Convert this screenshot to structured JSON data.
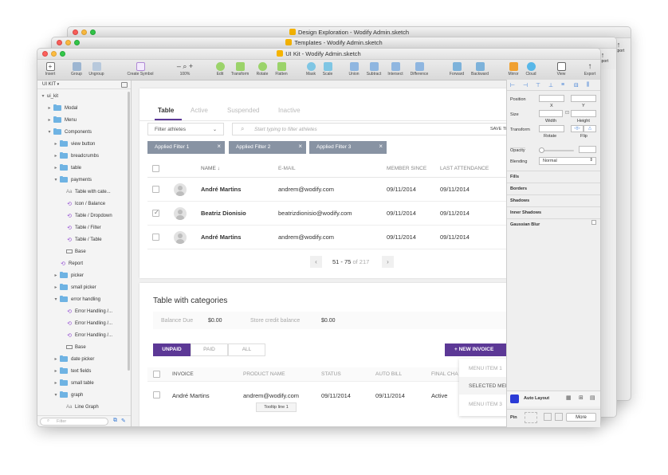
{
  "windows": {
    "back_title": "Design Exploration - Wodify Admin.sketch",
    "mid_title": "Templates - Wodify Admin.sketch",
    "front_title": "UI Kit - Wodify Admin.sketch",
    "back_export_label": "Export",
    "mid_export_label": "Export"
  },
  "toolbar": {
    "insert": "Insert",
    "group": "Group",
    "ungroup": "Ungroup",
    "create_symbol": "Create Symbol",
    "zoom_minus": "–",
    "zoom_plus": "+",
    "zoom_value": "100%",
    "edit": "Edit",
    "transform": "Transform",
    "rotate": "Rotate",
    "flatten": "Flatten",
    "mask": "Mask",
    "scale": "Scale",
    "union": "Union",
    "subtract": "Subtract",
    "intersect": "Intersect",
    "difference": "Difference",
    "forward": "Forward",
    "backward": "Backward",
    "mirror": "Mirror",
    "cloud": "Cloud",
    "view": "View",
    "export": "Export"
  },
  "sidebar": {
    "page": "UI KIT",
    "filter_placeholder": "Filter",
    "layers": [
      {
        "label": "ui_kit",
        "icon": "none",
        "depth": 0,
        "open": true
      },
      {
        "label": "Modal",
        "icon": "folder",
        "depth": 1,
        "open": false
      },
      {
        "label": "Menu",
        "icon": "folder",
        "depth": 1,
        "open": false
      },
      {
        "label": "Components",
        "icon": "folder",
        "depth": 1,
        "open": true
      },
      {
        "label": "view button",
        "icon": "folder",
        "depth": 2,
        "open": false
      },
      {
        "label": "breadcrumbs",
        "icon": "folder",
        "depth": 2,
        "open": false
      },
      {
        "label": "table",
        "icon": "folder",
        "depth": 2,
        "open": false
      },
      {
        "label": "payments",
        "icon": "folder",
        "depth": 2,
        "open": true
      },
      {
        "label": "Table with cate...",
        "icon": "text",
        "depth": 3
      },
      {
        "label": "Icon / Balance",
        "icon": "symbol",
        "depth": 3
      },
      {
        "label": "Table / Dropdown",
        "icon": "symbol",
        "depth": 3
      },
      {
        "label": "Table / Filter",
        "icon": "symbol",
        "depth": 3
      },
      {
        "label": "Table / Table",
        "icon": "symbol",
        "depth": 3
      },
      {
        "label": "Base",
        "icon": "rect",
        "depth": 3
      },
      {
        "label": "Report",
        "icon": "symbol",
        "depth": 2
      },
      {
        "label": "picker",
        "icon": "folder",
        "depth": 2,
        "open": false
      },
      {
        "label": "small picker",
        "icon": "folder",
        "depth": 2,
        "open": false
      },
      {
        "label": "error handling",
        "icon": "folder",
        "depth": 2,
        "open": true
      },
      {
        "label": "Error Handling /...",
        "icon": "symbol",
        "depth": 3
      },
      {
        "label": "Error Handling /...",
        "icon": "symbol",
        "depth": 3
      },
      {
        "label": "Error Handling /...",
        "icon": "symbol",
        "depth": 3
      },
      {
        "label": "Base",
        "icon": "rect",
        "depth": 3
      },
      {
        "label": "date picker",
        "icon": "folder",
        "depth": 2,
        "open": false
      },
      {
        "label": "text fields",
        "icon": "folder",
        "depth": 2,
        "open": false
      },
      {
        "label": "small table",
        "icon": "folder",
        "depth": 2,
        "open": false
      },
      {
        "label": "graph",
        "icon": "folder",
        "depth": 2,
        "open": true
      },
      {
        "label": "Line Graph",
        "icon": "text",
        "depth": 3
      }
    ]
  },
  "tabs": [
    "Table",
    "Active",
    "Suspended",
    "Inactive"
  ],
  "filter": {
    "dropdown": "Filter athletes",
    "search_placeholder": "Start typing to filter athletes",
    "save_label": "SAVE TH",
    "chips": [
      "Applied Filter 1",
      "Applied Filter 2",
      "Applied Filter 3"
    ]
  },
  "table": {
    "columns": [
      "NAME",
      "E-MAIL",
      "MEMBER SINCE",
      "LAST ATTENDANCE"
    ],
    "rows": [
      {
        "name": "André Martins",
        "email": "andrem@wodify.com",
        "since": "09/11/2014",
        "last": "09/11/2014",
        "checked": false
      },
      {
        "name": "Beatriz Dionisio",
        "email": "beatrizdionisio@wodify.com",
        "since": "09/11/2014",
        "last": "09/11/2014",
        "checked": true
      },
      {
        "name": "André Martins",
        "email": "andrem@wodify.com",
        "since": "09/11/2014",
        "last": "09/11/2014",
        "checked": false
      }
    ],
    "pagination": {
      "range": "51 - 75",
      "of": "of 217"
    }
  },
  "categories": {
    "title": "Table with categories",
    "balance_label": "Balance Due",
    "balance_value": "$0.00",
    "credit_label": "Store credit balance",
    "credit_value": "$0.00",
    "segments": [
      "UNPAID",
      "PAID",
      "ALL"
    ],
    "new_invoice": "NEW INVOICE",
    "columns": [
      "INVOICE",
      "PRODUCT NAME",
      "STATUS",
      "AUTO BILL",
      "FINAL CHA"
    ],
    "row": {
      "invoice": "André Martins",
      "product": "andrem@wodify.com",
      "status": "09/11/2014",
      "auto_bill": "09/11/2014",
      "final": "Active"
    },
    "menu": [
      "MENU ITEM 1",
      "SELECTED MEN",
      "MENU ITEM 3"
    ],
    "tooltip": "Tooltip line 1"
  },
  "inspector": {
    "position": "Position",
    "x": "X",
    "y": "Y",
    "size": "Size",
    "width": "Width",
    "height": "Height",
    "transform": "Transform",
    "rotate": "Rotate",
    "flip": "Flip",
    "opacity": "Opacity",
    "blending": "Blending",
    "blend_value": "Normal",
    "sections": [
      "Fills",
      "Borders",
      "Shadows",
      "Inner Shadows",
      "Gaussian Blur"
    ],
    "auto_layout": "Auto Layout",
    "pin": "Pin",
    "more": "More"
  },
  "colors": {
    "accent": "#5c3896",
    "chip": "#8893a3",
    "folder": "#6fb3e3"
  }
}
